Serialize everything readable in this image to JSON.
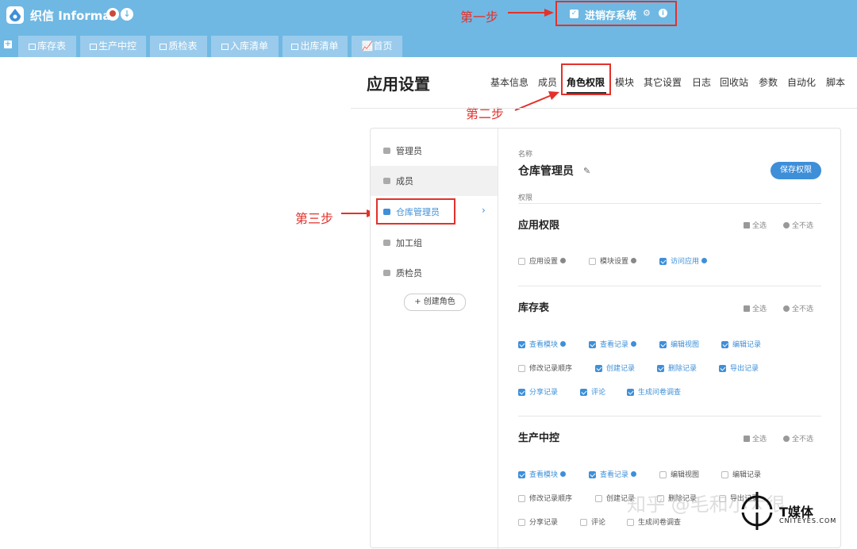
{
  "topbar": {
    "brand": "织信 Informat",
    "app_title": "进销存系统"
  },
  "tabs": [
    {
      "label": "库存表"
    },
    {
      "label": "生产中控"
    },
    {
      "label": "质检表"
    },
    {
      "label": "入库清单"
    },
    {
      "label": "出库清单"
    },
    {
      "label": "首页"
    }
  ],
  "annotations": {
    "step1": "第一步",
    "step2": "第二步",
    "step3": "第三步"
  },
  "settings": {
    "title": "应用设置",
    "nav": [
      "基本信息",
      "成员",
      "角色权限",
      "模块",
      "其它设置",
      "日志",
      "回收站",
      "参数",
      "自动化",
      "脚本"
    ]
  },
  "roles": {
    "items": [
      {
        "label": "管理员",
        "icon": "lock-icon"
      },
      {
        "label": "成员",
        "icon": "users-icon"
      },
      {
        "label": "仓库管理员",
        "icon": "users-icon"
      },
      {
        "label": "加工组",
        "icon": "users-icon"
      },
      {
        "label": "质检员",
        "icon": "users-icon"
      }
    ],
    "create_label": "+ 创建角色"
  },
  "detail": {
    "name_label": "名称",
    "role_name": "仓库管理员",
    "save_label": "保存权限",
    "perm_label": "权限",
    "select_all": "全选",
    "select_none": "全不选",
    "sections": [
      {
        "title": "应用权限",
        "perms": [
          {
            "label": "应用设置",
            "checked": false,
            "info": true
          },
          {
            "label": "模块设置",
            "checked": false,
            "info": true
          },
          {
            "label": "访问应用",
            "checked": true,
            "info": true
          }
        ]
      },
      {
        "title": "库存表",
        "perms": [
          {
            "label": "查看模块",
            "checked": true,
            "info": true
          },
          {
            "label": "查看记录",
            "checked": true,
            "info": true
          },
          {
            "label": "编辑视图",
            "checked": true,
            "info": false
          },
          {
            "label": "编辑记录",
            "checked": true,
            "info": false
          },
          {
            "label": "修改记录顺序",
            "checked": false,
            "info": false
          },
          {
            "label": "创建记录",
            "checked": true,
            "info": false
          },
          {
            "label": "删除记录",
            "checked": true,
            "info": false
          },
          {
            "label": "导出记录",
            "checked": true,
            "info": false
          },
          {
            "label": "分享记录",
            "checked": true,
            "info": false
          },
          {
            "label": "评论",
            "checked": true,
            "info": false
          },
          {
            "label": "生成问卷调查",
            "checked": true,
            "info": false
          }
        ]
      },
      {
        "title": "生产中控",
        "perms": [
          {
            "label": "查看模块",
            "checked": true,
            "info": true
          },
          {
            "label": "查看记录",
            "checked": true,
            "info": true
          },
          {
            "label": "编辑视图",
            "checked": false,
            "info": false
          },
          {
            "label": "编辑记录",
            "checked": false,
            "info": false
          },
          {
            "label": "修改记录顺序",
            "checked": false,
            "info": false
          },
          {
            "label": "创建记录",
            "checked": false,
            "info": false
          },
          {
            "label": "删除记录",
            "checked": false,
            "info": false
          },
          {
            "label": "导出记录",
            "checked": false,
            "info": false
          },
          {
            "label": "分享记录",
            "checked": false,
            "info": false
          },
          {
            "label": "评论",
            "checked": false,
            "info": false
          },
          {
            "label": "生成问卷调查",
            "checked": false,
            "info": false
          }
        ]
      }
    ]
  },
  "watermark": {
    "text": "知乎 @毛和小大很",
    "brand": "T媒体",
    "site": "CNITEYES.COM"
  }
}
